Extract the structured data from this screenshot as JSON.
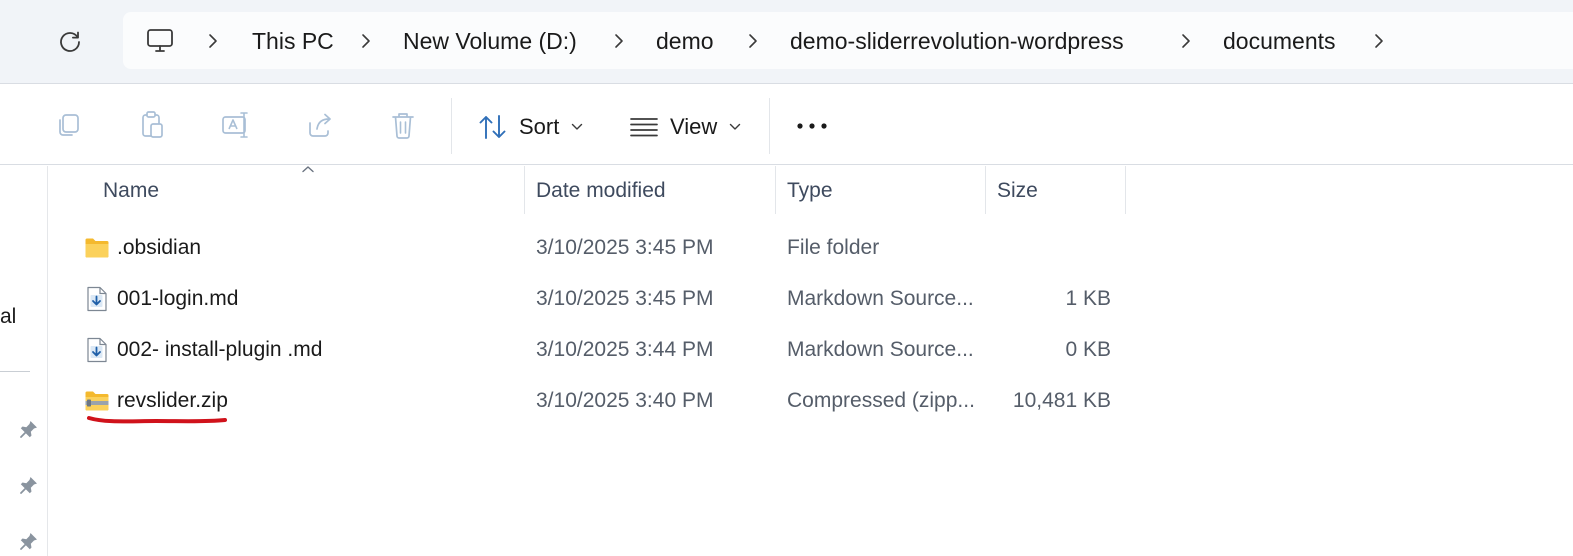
{
  "breadcrumb": {
    "items": [
      "This PC",
      "New Volume (D:)",
      "demo",
      "demo-sliderrevolution-wordpress",
      "documents"
    ]
  },
  "toolbar": {
    "sort_label": "Sort",
    "view_label": "View"
  },
  "nav_pane": {
    "partial_label": "al"
  },
  "file_list": {
    "columns": [
      "Name",
      "Date modified",
      "Type",
      "Size"
    ],
    "rows": [
      {
        "name": ".obsidian",
        "date": "3/10/2025 3:45 PM",
        "type": "File folder",
        "size": "",
        "icon": "folder-icon"
      },
      {
        "name": "001-login.md",
        "date": "3/10/2025 3:45 PM",
        "type": "Markdown Source...",
        "size": "1 KB",
        "icon": "markdown-file-icon"
      },
      {
        "name": "002- install-plugin .md",
        "date": "3/10/2025 3:44 PM",
        "type": "Markdown Source...",
        "size": "0 KB",
        "icon": "markdown-file-icon"
      },
      {
        "name": "revslider.zip",
        "date": "3/10/2025 3:40 PM",
        "type": "Compressed (zipp...",
        "size": "10,481 KB",
        "icon": "zip-folder-icon"
      }
    ]
  },
  "colors": {
    "topbar_bg": "#f1f4f8",
    "folder_yellow": "#f8c842",
    "annotation_red": "#d0121b"
  }
}
